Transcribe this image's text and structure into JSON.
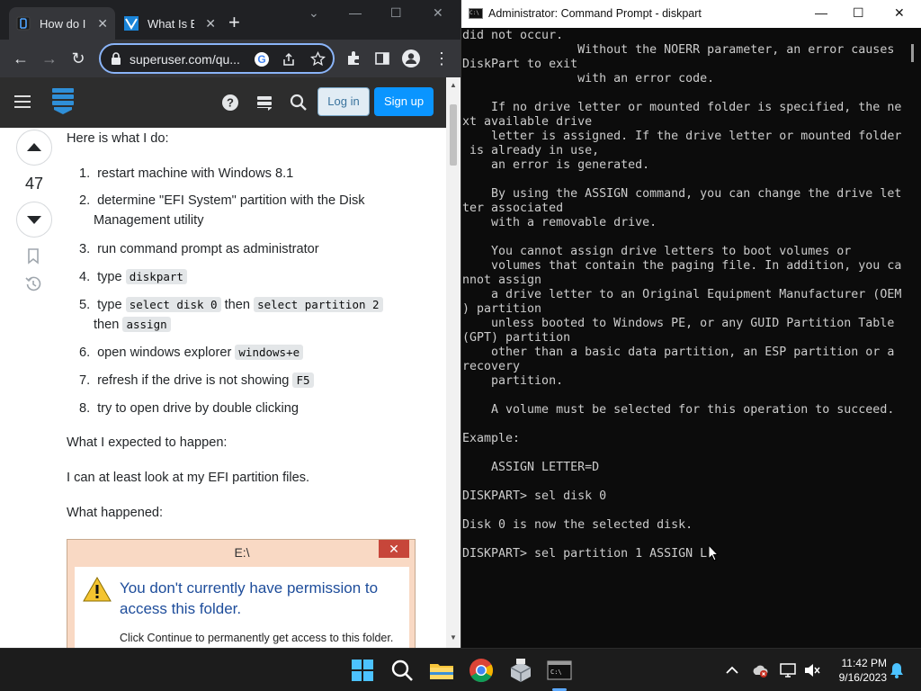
{
  "browser": {
    "tabs": [
      {
        "title": "How do I"
      },
      {
        "title": "What Is E"
      }
    ],
    "url": "superuser.com/qu..."
  },
  "site": {
    "login_label": "Log in",
    "signup_label": "Sign up"
  },
  "post": {
    "vote_count": "47",
    "intro": "Here is what I do:",
    "steps": [
      {
        "num": "1.",
        "text": "restart machine with Windows 8.1"
      },
      {
        "num": "2.",
        "text": "determine \"EFI System\" partition with the Disk Management utility"
      },
      {
        "num": "3.",
        "text": "run command prompt as administrator"
      },
      {
        "num": "4.",
        "text": "type",
        "code": "diskpart"
      },
      {
        "num": "5.",
        "text": "type",
        "code1": "select disk 0",
        "mid1": "then",
        "code2": "select partition 2",
        "mid2": "then",
        "code3": "assign"
      },
      {
        "num": "6.",
        "text": "open windows explorer",
        "code": "windows+e"
      },
      {
        "num": "7.",
        "text": "refresh if the drive is not showing",
        "code": "F5"
      },
      {
        "num": "8.",
        "text": "try to open drive by double clicking"
      }
    ],
    "expected_heading": "What I expected to happen:",
    "expected_text": "I can at least look at my EFI partition files.",
    "happened_heading": "What happened:",
    "dialog": {
      "title": "E:\\",
      "close": "✕",
      "message": "You don't currently have permission to access this folder.",
      "sub": "Click Continue to permanently get access to this folder."
    }
  },
  "cmd": {
    "title": "Administrator: Command Prompt - diskpart",
    "output": "did not occur.\n                Without the NOERR parameter, an error causes\nDiskPart to exit\n                with an error code.\n\n    If no drive letter or mounted folder is specified, the ne\nxt available drive\n    letter is assigned. If the drive letter or mounted folder\n is already in use,\n    an error is generated.\n\n    By using the ASSIGN command, you can change the drive let\nter associated\n    with a removable drive.\n\n    You cannot assign drive letters to boot volumes or\n    volumes that contain the paging file. In addition, you ca\nnnot assign\n    a drive letter to an Original Equipment Manufacturer (OEM\n) partition\n    unless booted to Windows PE, or any GUID Partition Table\n(GPT) partition\n    other than a basic data partition, an ESP partition or a\nrecovery\n    partition.\n\n    A volume must be selected for this operation to succeed.\n\nExample:\n\n    ASSIGN LETTER=D\n\nDISKPART> sel disk 0\n\nDisk 0 is now the selected disk.\n\nDISKPART> sel partition 1 ASSIGN L"
  },
  "taskbar": {
    "time": "11:42 PM",
    "date": "9/16/2023"
  }
}
